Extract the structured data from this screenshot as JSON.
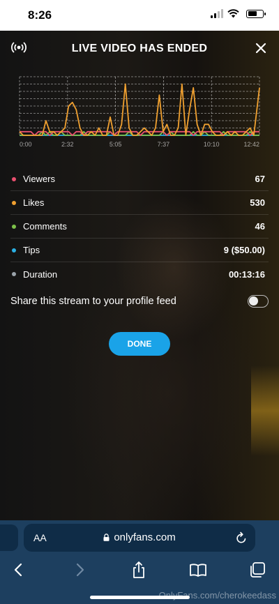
{
  "status_bar": {
    "time": "8:26"
  },
  "header": {
    "title": "LIVE VIDEO HAS ENDED"
  },
  "chart_data": {
    "type": "line",
    "x_tick_labels": [
      "0:00",
      "2:32",
      "5:05",
      "7:37",
      "10:10",
      "12:42"
    ],
    "x": [
      0.0,
      0.2,
      0.4,
      0.6,
      0.8,
      1.0,
      1.2,
      1.4,
      1.6,
      1.8,
      2.0,
      2.2,
      2.4,
      2.6,
      2.8,
      3.0,
      3.2,
      3.4,
      3.6,
      3.8,
      4.0,
      4.2,
      4.4,
      4.6,
      4.8,
      5.0,
      5.2,
      5.4,
      5.6,
      5.8,
      6.0,
      6.2,
      6.4,
      6.6,
      6.8,
      7.0,
      7.2,
      7.4,
      7.6,
      7.8,
      8.0,
      8.2,
      8.4,
      8.6,
      8.8,
      9.0,
      9.2,
      9.4,
      9.6,
      9.8,
      10.0,
      10.2,
      10.4,
      10.6,
      10.8,
      11.0,
      11.2,
      11.4,
      11.6,
      11.8,
      12.0,
      12.2,
      12.4,
      12.7
    ],
    "series": [
      {
        "name": "Likes",
        "color": "#f0a030",
        "values": [
          1,
          0,
          0,
          0,
          0,
          0,
          0,
          4,
          1,
          1,
          0,
          1,
          2,
          8,
          9,
          7,
          2,
          0,
          0,
          1,
          0,
          2,
          0,
          0,
          5,
          0,
          0,
          3,
          14,
          2,
          0,
          0,
          1,
          2,
          1,
          0,
          2,
          11,
          1,
          3,
          0,
          0,
          2,
          14,
          0,
          7,
          13,
          3,
          0,
          3,
          3,
          1,
          0,
          0,
          0,
          1,
          0,
          1,
          0,
          0,
          1,
          2,
          0,
          13
        ]
      },
      {
        "name": "Viewers",
        "color": "#e9506f",
        "values": [
          1,
          1,
          1,
          1,
          0,
          1,
          1,
          1,
          0,
          1,
          1,
          1,
          1,
          1,
          0,
          1,
          1,
          0,
          1,
          1,
          1,
          1,
          1,
          1,
          1,
          0,
          1,
          1,
          1,
          1,
          1,
          1,
          0,
          1,
          1,
          1,
          1,
          1,
          1,
          0,
          1,
          1,
          1,
          1,
          1,
          1,
          0,
          1,
          1,
          1,
          1,
          1,
          1,
          1,
          0,
          1,
          1,
          1,
          1,
          1,
          1,
          0,
          1,
          1
        ]
      },
      {
        "name": "Comments",
        "color": "#7dc24a",
        "values": [
          0,
          0,
          0,
          0,
          0,
          0,
          1,
          0,
          1,
          0,
          0,
          1,
          0,
          0,
          0,
          0,
          0,
          1,
          0,
          0,
          0,
          0,
          0,
          0,
          1,
          0,
          0,
          0,
          0,
          1,
          0,
          0,
          0,
          0,
          0,
          0,
          0,
          0,
          1,
          0,
          1,
          0,
          0,
          0,
          0,
          0,
          1,
          0,
          0,
          1,
          0,
          0,
          0,
          0,
          1,
          0,
          0,
          0,
          0,
          0,
          0,
          1,
          0,
          0
        ]
      },
      {
        "name": "Tips",
        "color": "#2bb0e3",
        "values": [
          0,
          0,
          0,
          0,
          0,
          0,
          0,
          0,
          0,
          0,
          0,
          0,
          0,
          0,
          0,
          0,
          0,
          0,
          0,
          0,
          0,
          0,
          0,
          0,
          0,
          0,
          0,
          0,
          0,
          0,
          0,
          0,
          0,
          0,
          0,
          0,
          0,
          0,
          0,
          0,
          0,
          0,
          0,
          0,
          0,
          0,
          0,
          0,
          0,
          0,
          0,
          0,
          0,
          0,
          0,
          0,
          0,
          0,
          0,
          0,
          0,
          0,
          0,
          0
        ]
      }
    ],
    "ylim": [
      0,
      16
    ],
    "grid": true
  },
  "stats": [
    {
      "label": "Viewers",
      "value": "67",
      "color": "#e9506f"
    },
    {
      "label": "Likes",
      "value": "530",
      "color": "#f0a030"
    },
    {
      "label": "Comments",
      "value": "46",
      "color": "#7dc24a"
    },
    {
      "label": "Tips",
      "value": "9 ($50.00)",
      "color": "#2bb0e3"
    },
    {
      "label": "Duration",
      "value": "00:13:16",
      "color": "#9aa3aa"
    }
  ],
  "share": {
    "label": "Share this stream to your profile feed",
    "enabled": false
  },
  "done_label": "DONE",
  "browser": {
    "aa_label": "AA",
    "url": "onlyfans.com"
  },
  "watermark": "OnlyFans.com/cherokeedass"
}
